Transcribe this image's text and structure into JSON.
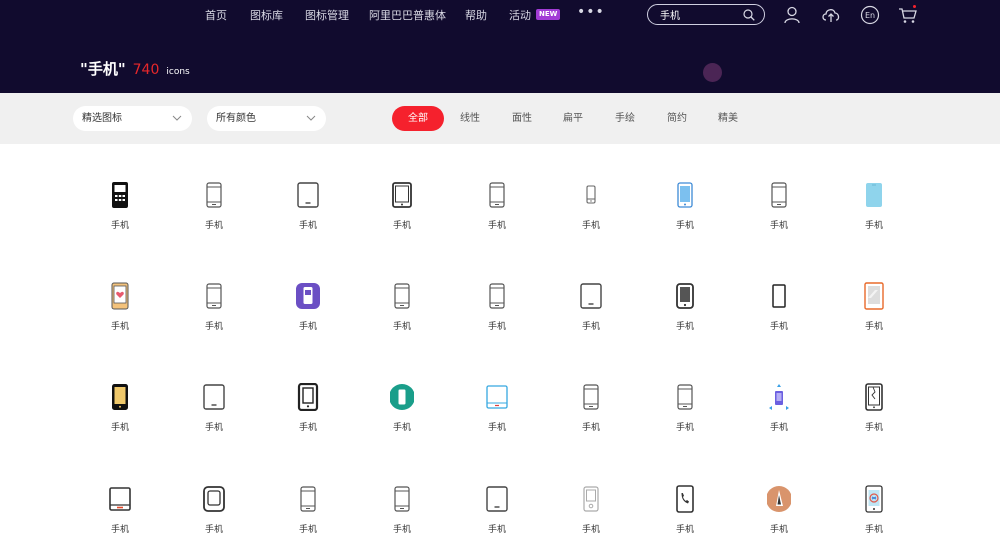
{
  "nav": {
    "items": [
      {
        "label": "首页"
      },
      {
        "label": "图标库"
      },
      {
        "label": "图标管理"
      },
      {
        "label": "阿里巴巴普惠体"
      },
      {
        "label": "帮助"
      },
      {
        "label": "活动"
      }
    ],
    "new_badge": "NEW",
    "more": "•••"
  },
  "search": {
    "value": "手机"
  },
  "header_icons": {
    "user": "user-icon",
    "upload": "upload-cloud-icon",
    "lang": "En",
    "cart": "cart-icon"
  },
  "title": {
    "query": "\"手机\"",
    "count": "740",
    "unit": "icons"
  },
  "filters": {
    "dropdown_1": "精选图标",
    "dropdown_2": "所有颜色",
    "tabs": [
      {
        "label": "全部",
        "active": true
      },
      {
        "label": "线性"
      },
      {
        "label": "面性"
      },
      {
        "label": "扁平"
      },
      {
        "label": "手绘"
      },
      {
        "label": "简约"
      },
      {
        "label": "精美"
      }
    ]
  },
  "colors": {
    "header_bg": "#110b2e",
    "accent": "#f5212d",
    "filter_bg": "#f0f0f0"
  },
  "icons": [
    {
      "label": "手机",
      "icon": "phone-keypad-icon"
    },
    {
      "label": "手机",
      "icon": "phone-outline-icon"
    },
    {
      "label": "手机",
      "icon": "tablet-outline-icon"
    },
    {
      "label": "手机",
      "icon": "tablet-thick-icon"
    },
    {
      "label": "手机",
      "icon": "phone-outline-icon"
    },
    {
      "label": "手机",
      "icon": "phone-small-icon"
    },
    {
      "label": "手机",
      "icon": "phone-blue-icon"
    },
    {
      "label": "手机",
      "icon": "phone-outline-icon"
    },
    {
      "label": "手机",
      "icon": "phone-flat-blue-icon"
    },
    {
      "label": "手机",
      "icon": "phone-heart-icon"
    },
    {
      "label": "手机",
      "icon": "phone-outline-icon"
    },
    {
      "label": "手机",
      "icon": "phone-purple-badge-icon"
    },
    {
      "label": "手机",
      "icon": "phone-outline-icon"
    },
    {
      "label": "手机",
      "icon": "phone-outline-icon"
    },
    {
      "label": "手机",
      "icon": "tablet-outline-icon"
    },
    {
      "label": "手机",
      "icon": "phone-dark-icon"
    },
    {
      "label": "手机",
      "icon": "phone-slim-icon"
    },
    {
      "label": "手机",
      "icon": "phone-orange-icon"
    },
    {
      "label": "手机",
      "icon": "phone-gold-icon"
    },
    {
      "label": "手机",
      "icon": "tablet-outline-icon"
    },
    {
      "label": "手机",
      "icon": "phone-thick-icon"
    },
    {
      "label": "手机",
      "icon": "phone-teal-circle-icon"
    },
    {
      "label": "手机",
      "icon": "tablet-blue-icon"
    },
    {
      "label": "手机",
      "icon": "phone-outline-icon"
    },
    {
      "label": "手机",
      "icon": "phone-outline-icon"
    },
    {
      "label": "手机",
      "icon": "phone-purple-arrows-icon"
    },
    {
      "label": "手机",
      "icon": "phone-broken-icon"
    },
    {
      "label": "手机",
      "icon": "tablet-red-icon"
    },
    {
      "label": "手机",
      "icon": "phone-rounded-icon"
    },
    {
      "label": "手机",
      "icon": "phone-outline-icon"
    },
    {
      "label": "手机",
      "icon": "phone-outline-icon"
    },
    {
      "label": "手机",
      "icon": "tablet-outline-icon"
    },
    {
      "label": "手机",
      "icon": "phone-grey-icon"
    },
    {
      "label": "手机",
      "icon": "phone-call-icon"
    },
    {
      "label": "手机",
      "icon": "phone-tan-circle-icon"
    },
    {
      "label": "手机",
      "icon": "phone-colorful-icon"
    }
  ]
}
